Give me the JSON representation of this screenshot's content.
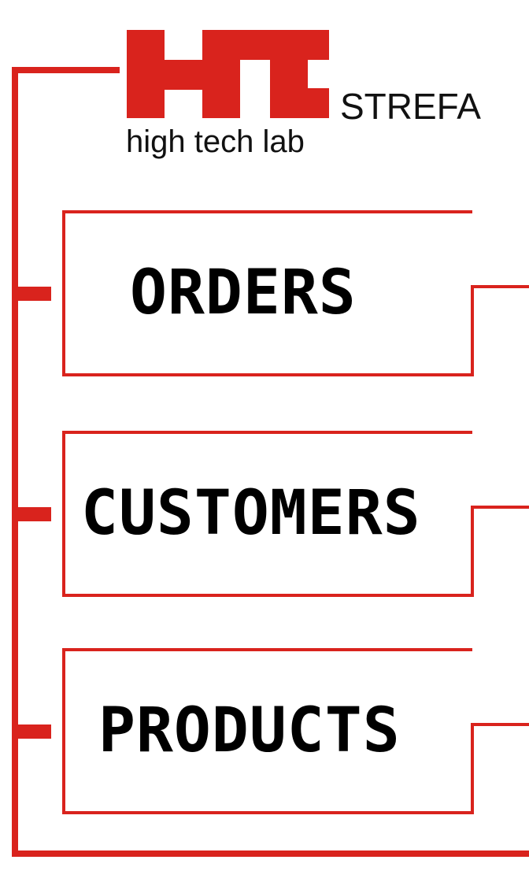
{
  "brand": {
    "logo_mark": "HT",
    "tagline": "high tech lab",
    "section": "STREFA",
    "accent_color": "#d9231d"
  },
  "menu": {
    "items": [
      {
        "label": "ORDERS"
      },
      {
        "label": "CUSTOMERS"
      },
      {
        "label": "PRODUCTS"
      }
    ]
  }
}
